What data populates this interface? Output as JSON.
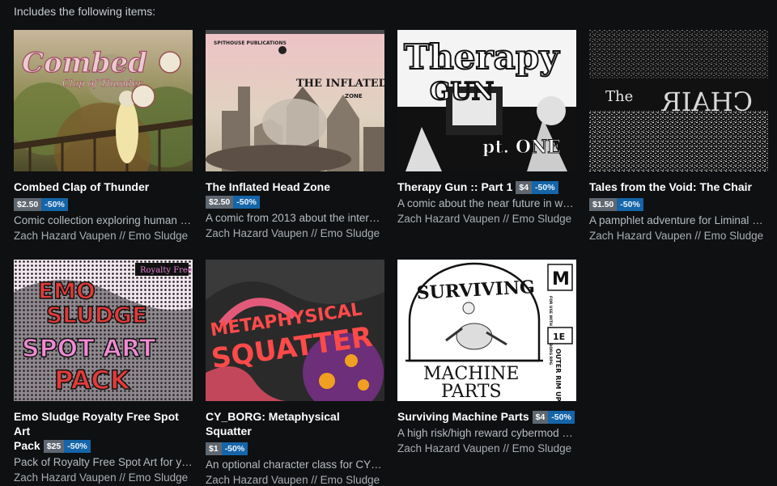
{
  "header": "Includes the following items:",
  "colors": {
    "background": "#0e1012",
    "price_bg": "#5f6770",
    "discount_bg": "#1565a8"
  },
  "items": [
    {
      "title": "Combed Clap of Thunder",
      "price": "$2.50",
      "discount": "-50%",
      "description": "Comic collection exploring human …",
      "author": "Zach Hazard Vaupen // Emo Sludge",
      "cover_text": [
        "Combed",
        "Clap of Thunder"
      ]
    },
    {
      "title": "The Inflated Head Zone",
      "price": "$2.50",
      "discount": "-50%",
      "description": "A comic from 2013 about the inter…",
      "author": "Zach Hazard Vaupen // Emo Sludge",
      "cover_text": [
        "SPITHOUSE PUBLICATIONS",
        "THE INFLATED HEAD",
        "ZONE"
      ]
    },
    {
      "title": "Therapy Gun :: Part 1",
      "price": "$4",
      "discount": "-50%",
      "description": "A comic about the near future in w…",
      "author": "Zach Hazard Vaupen // Emo Sludge",
      "cover_text": [
        "Therapy",
        "GUN",
        "pt. ONE"
      ]
    },
    {
      "title": "Tales from the Void: The Chair",
      "price": "$1.50",
      "discount": "-50%",
      "description": "A pamphlet adventure for Liminal …",
      "author": "Zach Hazard Vaupen // Emo Sludge",
      "cover_text": [
        "The",
        "CHAIR"
      ]
    },
    {
      "title": "Emo Sludge Royalty Free Spot Art Pack",
      "title_line1": "Emo Sludge Royalty Free Spot Art",
      "title_line2": "Pack",
      "price": "$25",
      "discount": "-50%",
      "description": "Pack of Royalty Free Spot Art for y…",
      "author": "Zach Hazard Vaupen // Emo Sludge",
      "cover_text": [
        "Royalty Free",
        "EMO",
        "SLUDGE",
        "SPOT ART",
        "PACK"
      ]
    },
    {
      "title": "CY_BORG: Metaphysical Squatter",
      "price": "$1",
      "discount": "-50%",
      "description": "An optional character class for CY_…",
      "author": "Zach Hazard Vaupen // Emo Sludge",
      "cover_text": [
        "METAPHYSICAL",
        "SQUATTER"
      ]
    },
    {
      "title": "Surviving Machine Parts",
      "price": "$4",
      "discount": "-50%",
      "description": "A high risk/high reward cybermod …",
      "author": "Zach Hazard Vaupen // Emo Sludge",
      "cover_text": [
        "SURVIVING",
        "MACHINE",
        "PARTS",
        "M",
        "FOR USE WITH THE CY_BORG RPG",
        "1E",
        "OUTER RIM UPRISING"
      ]
    }
  ]
}
